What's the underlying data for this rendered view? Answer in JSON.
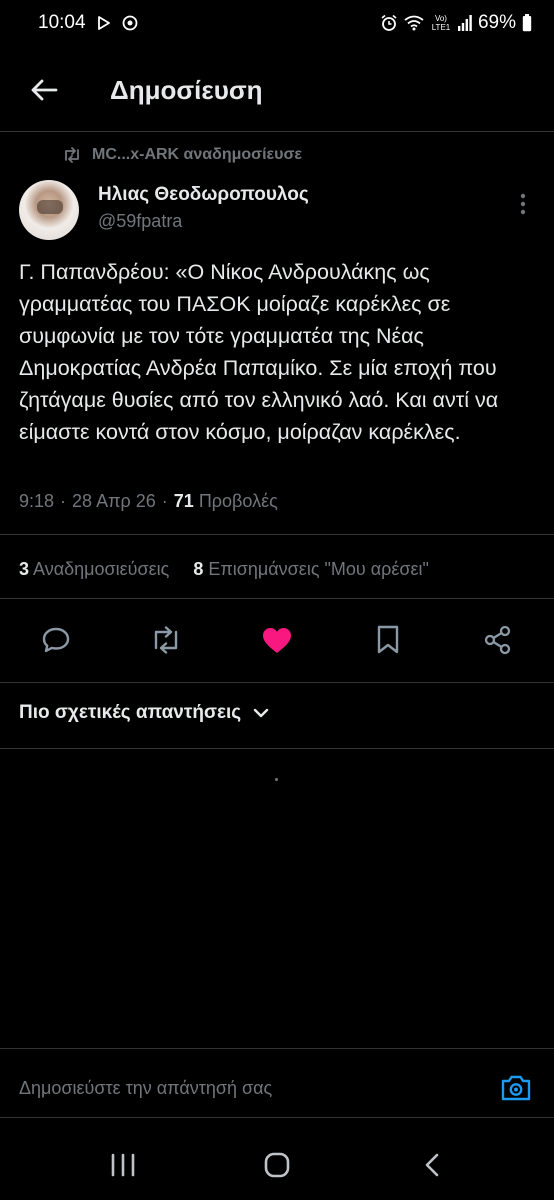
{
  "status_bar": {
    "time": "10:04",
    "battery": "69%",
    "network_label": "Vo) LTE1",
    "icons": [
      "play-store-icon",
      "chrome-icon",
      "alarm-icon",
      "wifi-icon",
      "signal-icon",
      "battery-icon"
    ]
  },
  "header": {
    "title": "Δημοσίευση"
  },
  "post": {
    "repost_by": "MC...x-ARK αναδημοσίευσε",
    "author_name": "Ηλιας Θεοδωροπουλος",
    "author_handle": "@59fpatra",
    "text": "Γ. Παπανδρέου: «Ο Νίκος Ανδρουλάκης ως γραμματέας του ΠΑΣΟΚ μοίραζε καρέκλες σε συμφωνία με τον τότε γραμματέα της Νέας Δημοκρατίας Ανδρέα Παπαμίκο. Σε μία εποχή που ζητάγαμε θυσίες από τον ελληνικό λαό. Και αντί να είμαστε κοντά στον κόσμο, μοίραζαν καρέκλες.",
    "time": "9:18",
    "date": "28 Απρ 26",
    "separator": "·",
    "views_count": "71",
    "views_label": "Προβολές",
    "reposts_count": "3",
    "reposts_label": "Αναδημοσιεύσεις",
    "likes_count": "8",
    "likes_label": "Επισημάνσεις \"Μου αρέσει\""
  },
  "actions": {
    "icons": [
      "reply-icon",
      "repost-icon",
      "like-icon",
      "bookmark-icon",
      "share-icon"
    ],
    "liked": true,
    "like_color": "#f91880"
  },
  "replies": {
    "sort_label": "Πιο σχετικές απαντήσεις"
  },
  "reply_bar": {
    "placeholder": "Δημοσιεύστε την απάντησή σας",
    "accent_color": "#1d9bf0"
  },
  "nav_bar": {
    "icons": [
      "recent-apps-icon",
      "home-icon",
      "back-icon"
    ]
  }
}
